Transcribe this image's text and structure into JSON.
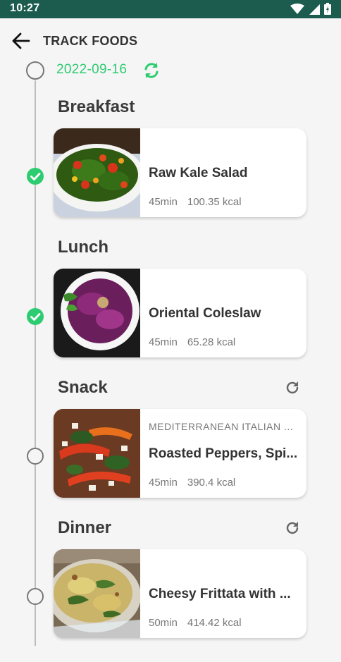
{
  "status": {
    "time": "10:27",
    "icons": [
      "wifi-icon",
      "cell-signal-icon",
      "battery-icon"
    ]
  },
  "header": {
    "title": "TRACK FOODS",
    "back_icon": "arrow-left-icon"
  },
  "date": {
    "value": "2022-09-16",
    "icon": "sync-icon",
    "color": "#2ecc71"
  },
  "meals": [
    {
      "label": "Breakfast",
      "status": "completed",
      "refresh": false,
      "recipe": {
        "cuisine": "",
        "name": "Raw Kale Salad",
        "time": "45min",
        "kcal": "100.35 kcal"
      }
    },
    {
      "label": "Lunch",
      "status": "completed",
      "refresh": false,
      "recipe": {
        "cuisine": "",
        "name": "Oriental Coleslaw",
        "time": "45min",
        "kcal": "65.28 kcal"
      }
    },
    {
      "label": "Snack",
      "status": "pending",
      "refresh": true,
      "recipe": {
        "cuisine": "MEDITERRANEAN ITALIAN ...",
        "name": "Roasted Peppers, Spi...",
        "time": "45min",
        "kcal": "390.4 kcal"
      }
    },
    {
      "label": "Dinner",
      "status": "pending",
      "refresh": true,
      "recipe": {
        "cuisine": "",
        "name": "Cheesy Frittata with ...",
        "time": "50min",
        "kcal": "414.42 kcal"
      }
    }
  ],
  "colors": {
    "status_bar": "#1b5c4e",
    "accent": "#2ecc71",
    "background": "#f5f5f5"
  }
}
